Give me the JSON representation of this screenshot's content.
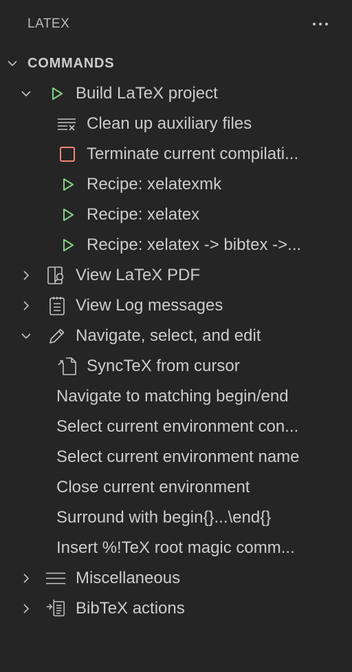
{
  "header": {
    "title": "LATEX"
  },
  "section": {
    "title": "COMMANDS"
  },
  "build": {
    "label": "Build LaTeX project",
    "children": {
      "clean": "Clean up auxiliary files",
      "terminate": "Terminate current compilati...",
      "recipe1": "Recipe: xelatexmk",
      "recipe2": "Recipe: xelatex",
      "recipe3": "Recipe: xelatex -> bibtex ->..."
    }
  },
  "view_pdf": {
    "label": "View LaTeX PDF"
  },
  "view_log": {
    "label": "View Log messages"
  },
  "navigate": {
    "label": "Navigate, select, and edit",
    "children": {
      "synctex": "SyncTeX from cursor",
      "match": "Navigate to matching begin/end",
      "select_content": "Select current environment con...",
      "select_name": "Select current environment name",
      "close_env": "Close current environment",
      "surround": "Surround with begin{}...\\end{}",
      "magic": "Insert %!TeX root magic comm..."
    }
  },
  "misc": {
    "label": "Miscellaneous"
  },
  "bibtex": {
    "label": "BibTeX actions"
  },
  "icons": {
    "more": "more-icon",
    "play": "play-icon",
    "clear": "clear-all-icon",
    "stop": "stop-icon",
    "pdf": "open-preview-icon",
    "log": "output-icon",
    "edit": "edit-icon",
    "go_to_file": "go-to-file-icon",
    "misc": "menu-icon",
    "bibtex": "references-icon"
  },
  "colors": {
    "background": "#252526",
    "text": "#cccccc",
    "play": "#89d185",
    "stop": "#f48771"
  }
}
